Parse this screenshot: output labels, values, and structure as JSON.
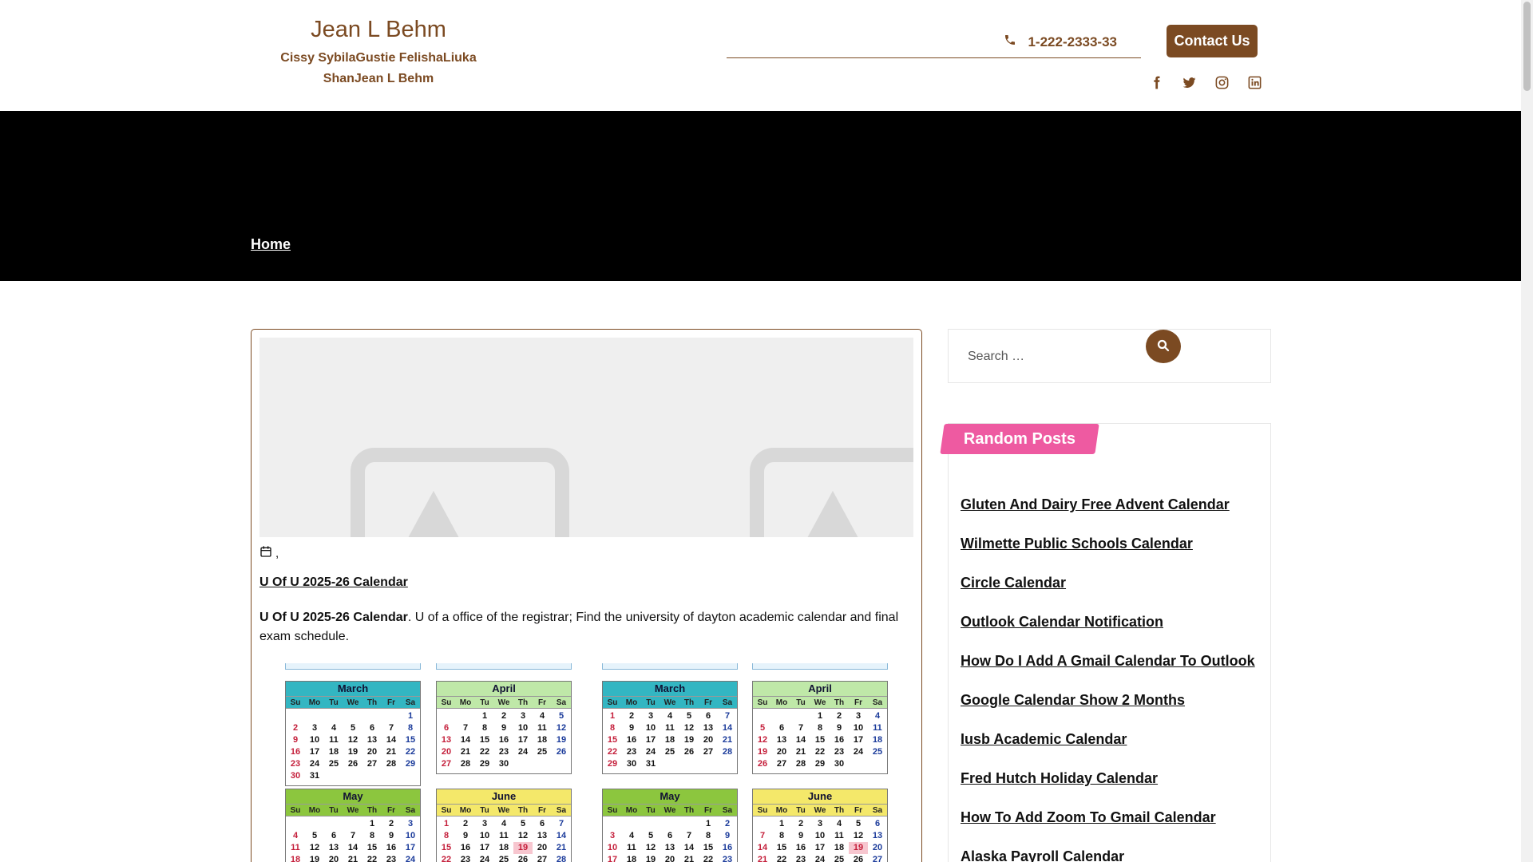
{
  "header": {
    "site_title": "Jean L Behm",
    "tagline_line1": "Cissy SybilaGustie FelishaLiuka",
    "tagline_line2": "ShanJean L Behm",
    "phone": "1-222-2333-33",
    "contact_label": "Contact Us",
    "socials": [
      "facebook-icon",
      "twitter-icon",
      "instagram-icon",
      "linkedin-icon"
    ]
  },
  "banner": {
    "breadcrumb": "Home"
  },
  "post": {
    "meta_separator": ",",
    "title": "U Of U 2025-26 Calendar",
    "excerpt_bold": "U Of U 2025-26 Calendar",
    "excerpt_rest": ". U of a office of the registrar; Find the university of dayton academic calendar and final exam schedule."
  },
  "sidebar": {
    "search_placeholder": "Search …",
    "random_title": "Random Posts",
    "random_posts": [
      "Gluten And Dairy Free Advent Calendar",
      "Wilmette Public Schools Calendar",
      "Circle Calendar",
      "Outlook Calendar Notification",
      "How Do I Add A Gmail Calendar To Outlook",
      "Google Calendar Show 2 Months",
      "Iusb Academic Calendar",
      "Fred Hutch Holiday Calendar",
      "How To Add Zoom To Gmail Calendar",
      "Alaska Payroll Calendar"
    ]
  },
  "calendar_image": {
    "dow": [
      "Su",
      "Mo",
      "Tu",
      "We",
      "Th",
      "Fr",
      "Sa"
    ],
    "months": [
      {
        "name": "March",
        "theme": "m-teal",
        "start": 6,
        "length": 31,
        "holidays": []
      },
      {
        "name": "April",
        "theme": "m-lgreen",
        "start": 2,
        "length": 30,
        "holidays": []
      },
      {
        "name": "March",
        "theme": "m-teal",
        "start": 0,
        "length": 31,
        "holidays": []
      },
      {
        "name": "April",
        "theme": "m-lgreen",
        "start": 3,
        "length": 30,
        "holidays": []
      },
      {
        "name": "May",
        "theme": "m-green",
        "start": 4,
        "length": 31,
        "holidays": []
      },
      {
        "name": "June",
        "theme": "m-yellow",
        "start": 0,
        "length": 30,
        "holidays": [
          19
        ]
      },
      {
        "name": "May",
        "theme": "m-green",
        "start": 5,
        "length": 31,
        "holidays": []
      },
      {
        "name": "June",
        "theme": "m-yellow",
        "start": 1,
        "length": 30,
        "holidays": [
          19
        ]
      }
    ]
  },
  "colors": {
    "brand": "#7b4a22",
    "banner": "#000000",
    "accent_pink": "#ee5aa1"
  }
}
